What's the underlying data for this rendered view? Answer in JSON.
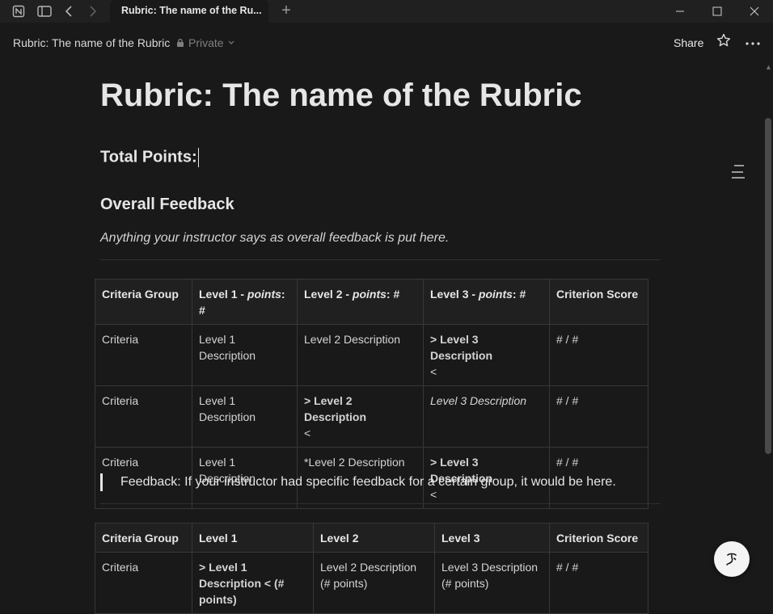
{
  "window": {
    "tab_title": "Rubric: The name of the Ru...",
    "new_tab_symbol": "+"
  },
  "topbar": {
    "breadcrumb": "Rubric: The name of the Rubric",
    "privacy": "Private",
    "share_label": "Share"
  },
  "page": {
    "title": "Rubric: The name of the Rubric",
    "total_points_label": "Total Points:",
    "overall_feedback_heading": "Overall Feedback",
    "overall_feedback_text": "Anything your instructor says as overall feedback is put here.",
    "callout_text": "Feedback: If your instructor had specific feedback for a certain group, it would be here."
  },
  "table1": {
    "headers": {
      "c1": "Criteria Group",
      "c2_a": "Level 1 - ",
      "c2_b": "points",
      "c2_c": ": #",
      "c3_a": "Level 2 - ",
      "c3_b": "points",
      "c3_c": ": #",
      "c4_a": "Level 3 - ",
      "c4_b": "points",
      "c4_c": ": #",
      "c5": "Criterion Score"
    },
    "rows": [
      {
        "c1": "Criteria",
        "c2": "Level 1 Description",
        "c3": "Level 2 Description",
        "c4_a": "> Level 3 Description",
        "c4_b": "<",
        "c5": "# / #"
      },
      {
        "c1": "Criteria",
        "c2": "Level 1 Description",
        "c3_a": "> Level 2 Description",
        "c3_b": "<",
        "c4": "Level 3 Description",
        "c5": "# / #"
      },
      {
        "c1": "Criteria",
        "c2": "Level 1 Description",
        "c3": "*Level 2 Description",
        "c4_a": "> Level 3 Description",
        "c4_b": "<",
        "c5": "# / #"
      }
    ]
  },
  "table2": {
    "headers": [
      "Criteria Group",
      "Level 1",
      "Level 2",
      "Level 3",
      "Criterion Score"
    ],
    "rows": [
      {
        "c1": "Criteria",
        "c2": "> Level 1 Description < (# points)",
        "c3": "Level 2 Description (# points)",
        "c4": "Level 3 Description (# points)",
        "c5": "# / #"
      }
    ]
  },
  "colors": {
    "background": "#191919",
    "text": "#d4d4d4",
    "heading": "#e6e6e6",
    "border": "#373737"
  }
}
